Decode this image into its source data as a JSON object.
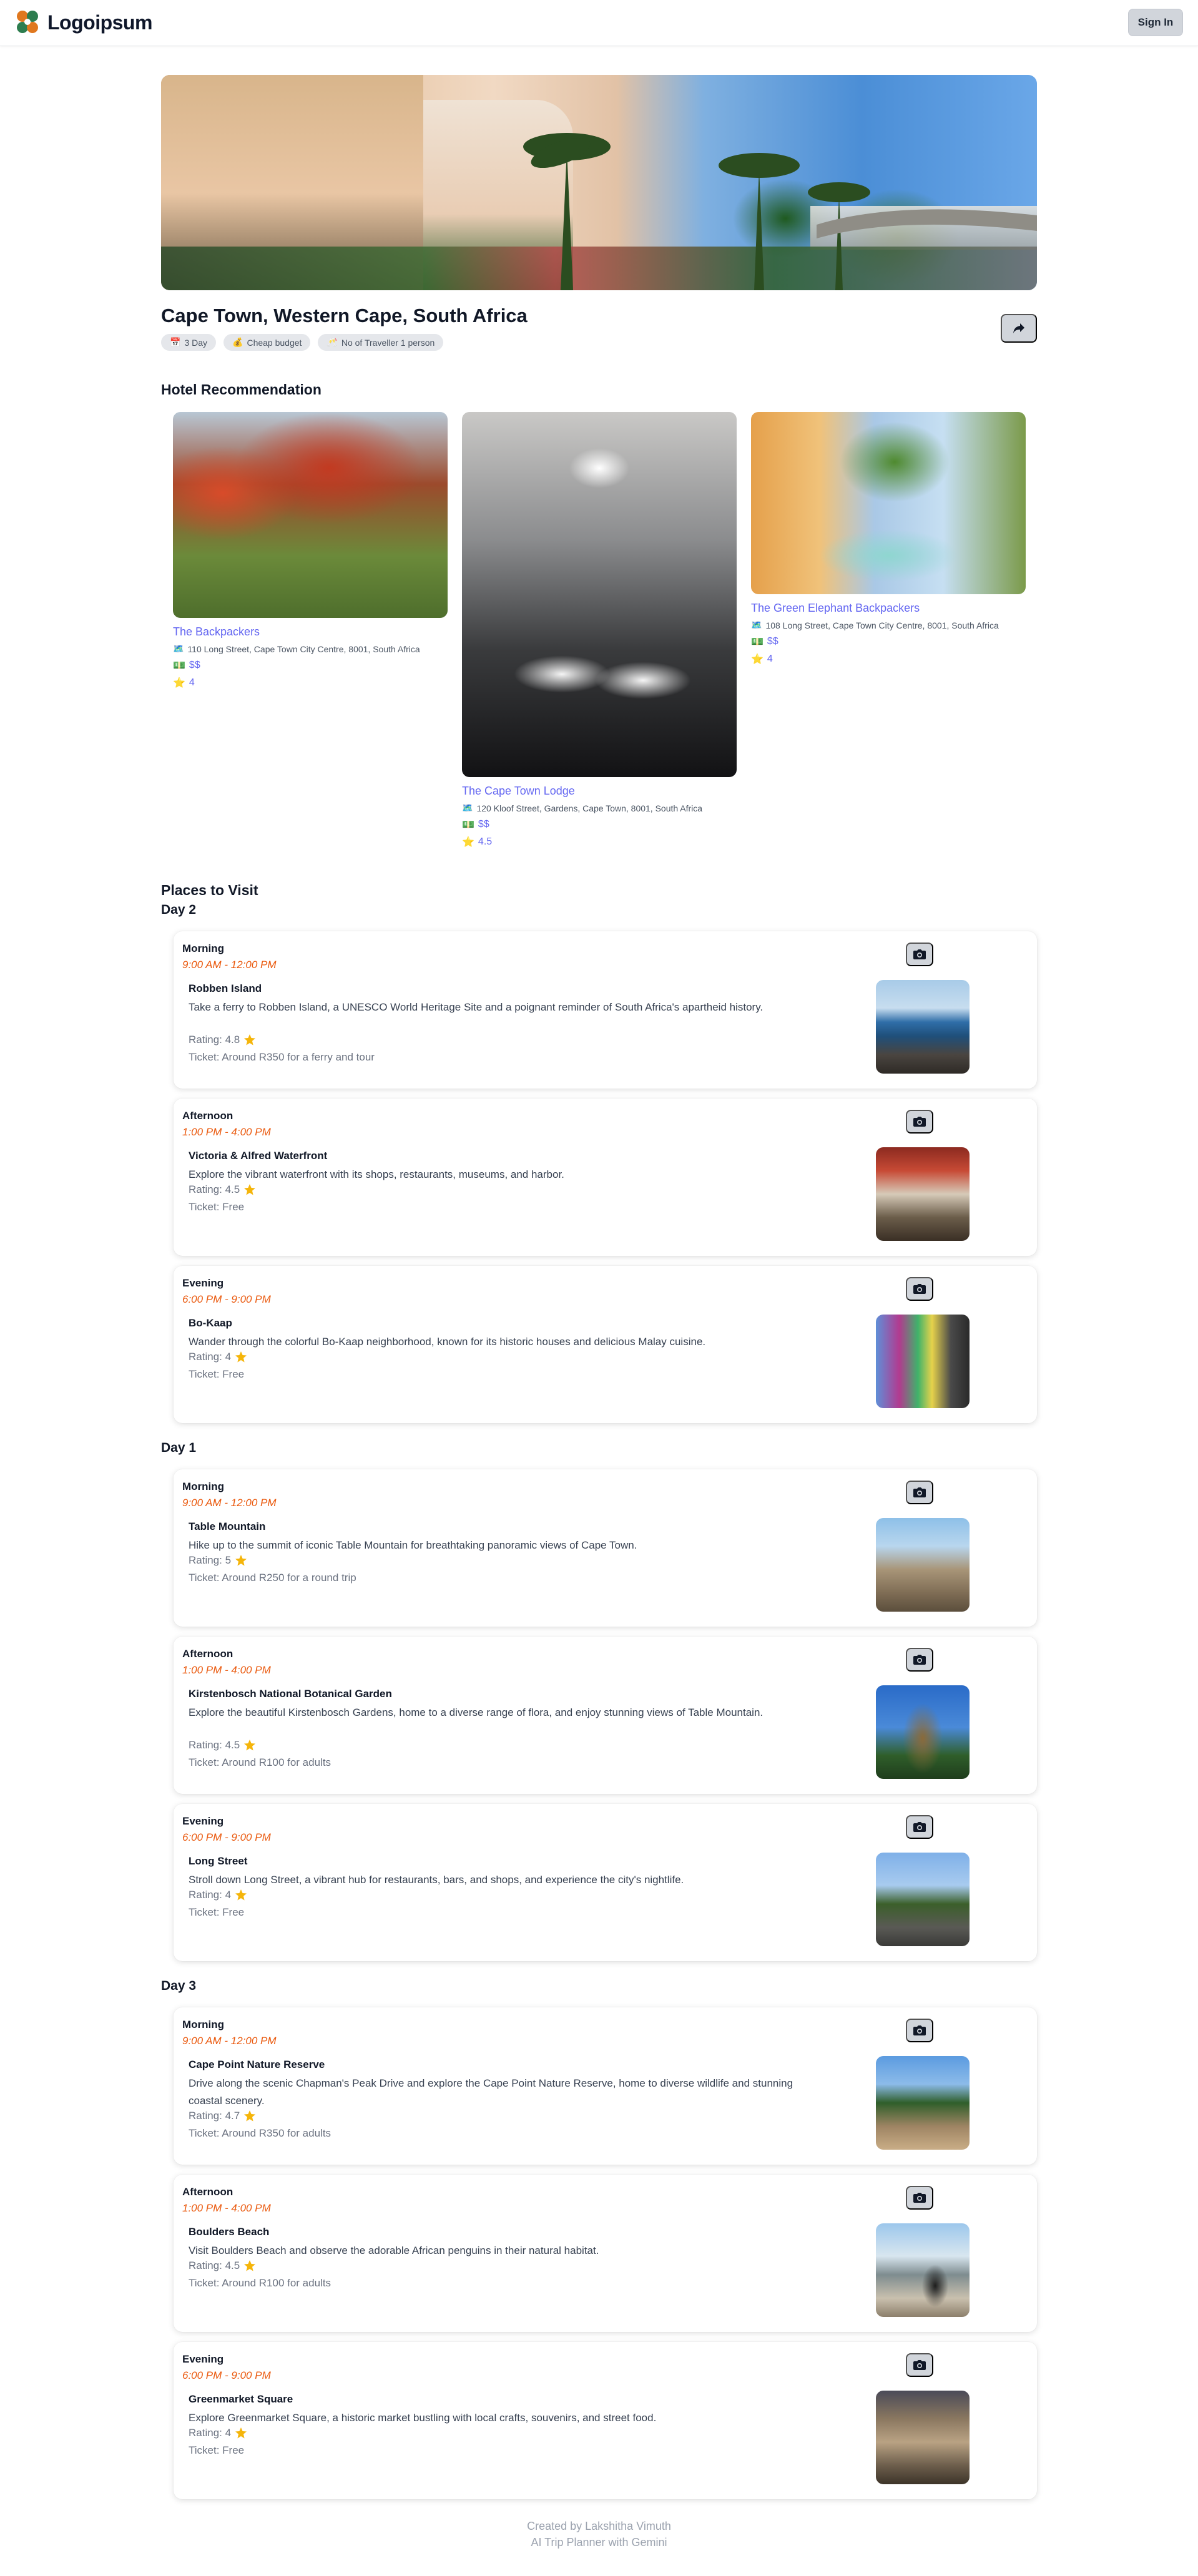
{
  "header": {
    "logo_text": "Logoipsum",
    "signin_label": "Sign In"
  },
  "trip": {
    "location": "Cape Town, Western Cape, South Africa",
    "badges": [
      {
        "icon": "calendar-icon",
        "emoji": "📅",
        "label": "3 Day"
      },
      {
        "icon": "money-bag-icon",
        "emoji": "💰",
        "label": "Cheap budget"
      },
      {
        "icon": "traveller-icon",
        "emoji": "🥂",
        "label": "No of Traveller 1 person"
      }
    ]
  },
  "hotels_section": {
    "title": "Hotel Recommendation",
    "hotels": [
      {
        "name": "The Backpackers",
        "address": "110 Long Street, Cape Town City Centre, 8001, South Africa",
        "price": "$$",
        "rating": "4"
      },
      {
        "name": "The Cape Town Lodge",
        "address": "120 Kloof Street, Gardens, Cape Town, 8001, South Africa",
        "price": "$$",
        "rating": "4.5"
      },
      {
        "name": "The Green Elephant Backpackers",
        "address": "108 Long Street, Cape Town City Centre, 8001, South Africa",
        "price": "$$",
        "rating": "4"
      }
    ]
  },
  "places_section": {
    "title": "Places to Visit",
    "days": [
      {
        "label": "Day 2",
        "slots": [
          {
            "time_of_day": "Morning",
            "time": "9:00 AM - 12:00 PM",
            "name": "Robben Island",
            "description": "Take a ferry to Robben Island, a UNESCO World Heritage Site and a poignant reminder of South Africa's apartheid history.",
            "rating": "Rating: 4.8",
            "ticket": "Ticket: Around R350 for a ferry and tour"
          },
          {
            "time_of_day": "Afternoon",
            "time": "1:00 PM - 4:00 PM",
            "name": "Victoria & Alfred Waterfront",
            "description": "Explore the vibrant waterfront with its shops, restaurants, museums, and harbor.",
            "rating": "Rating: 4.5",
            "ticket": "Ticket: Free"
          },
          {
            "time_of_day": "Evening",
            "time": "6:00 PM - 9:00 PM",
            "name": "Bo-Kaap",
            "description": "Wander through the colorful Bo-Kaap neighborhood, known for its historic houses and delicious Malay cuisine.",
            "rating": "Rating: 4",
            "ticket": "Ticket: Free"
          }
        ]
      },
      {
        "label": "Day 1",
        "slots": [
          {
            "time_of_day": "Morning",
            "time": "9:00 AM - 12:00 PM",
            "name": "Table Mountain",
            "description": "Hike up to the summit of iconic Table Mountain for breathtaking panoramic views of Cape Town.",
            "rating": "Rating: 5",
            "ticket": "Ticket: Around R250 for a round trip"
          },
          {
            "time_of_day": "Afternoon",
            "time": "1:00 PM - 4:00 PM",
            "name": "Kirstenbosch National Botanical Garden",
            "description": "Explore the beautiful Kirstenbosch Gardens, home to a diverse range of flora, and enjoy stunning views of Table Mountain.",
            "rating": "Rating: 4.5",
            "ticket": "Ticket: Around R100 for adults"
          },
          {
            "time_of_day": "Evening",
            "time": "6:00 PM - 9:00 PM",
            "name": "Long Street",
            "description": "Stroll down Long Street, a vibrant hub for restaurants, bars, and shops, and experience the city's nightlife.",
            "rating": "Rating: 4",
            "ticket": "Ticket: Free"
          }
        ]
      },
      {
        "label": "Day 3",
        "slots": [
          {
            "time_of_day": "Morning",
            "time": "9:00 AM - 12:00 PM",
            "name": "Cape Point Nature Reserve",
            "description": "Drive along the scenic Chapman's Peak Drive and explore the Cape Point Nature Reserve, home to diverse wildlife and stunning coastal scenery.",
            "rating": "Rating: 4.7",
            "ticket": "Ticket: Around R350 for adults"
          },
          {
            "time_of_day": "Afternoon",
            "time": "1:00 PM - 4:00 PM",
            "name": "Boulders Beach",
            "description": "Visit Boulders Beach and observe the adorable African penguins in their natural habitat.",
            "rating": "Rating: 4.5",
            "ticket": "Ticket: Around R100 for adults"
          },
          {
            "time_of_day": "Evening",
            "time": "6:00 PM - 9:00 PM",
            "name": "Greenmarket Square",
            "description": "Explore Greenmarket Square, a historic market bustling with local crafts, souvenirs, and street food.",
            "rating": "Rating: 4",
            "ticket": "Ticket: Free"
          }
        ]
      }
    ]
  },
  "footer": {
    "line1": "Created by Lakshitha Vimuth",
    "line2": "AI Trip Planner with Gemini"
  },
  "colors": {
    "accent": "#6366f1",
    "time_range": "#ea580c",
    "star": "#f5b50a",
    "button_bg": "#d1d5db"
  }
}
